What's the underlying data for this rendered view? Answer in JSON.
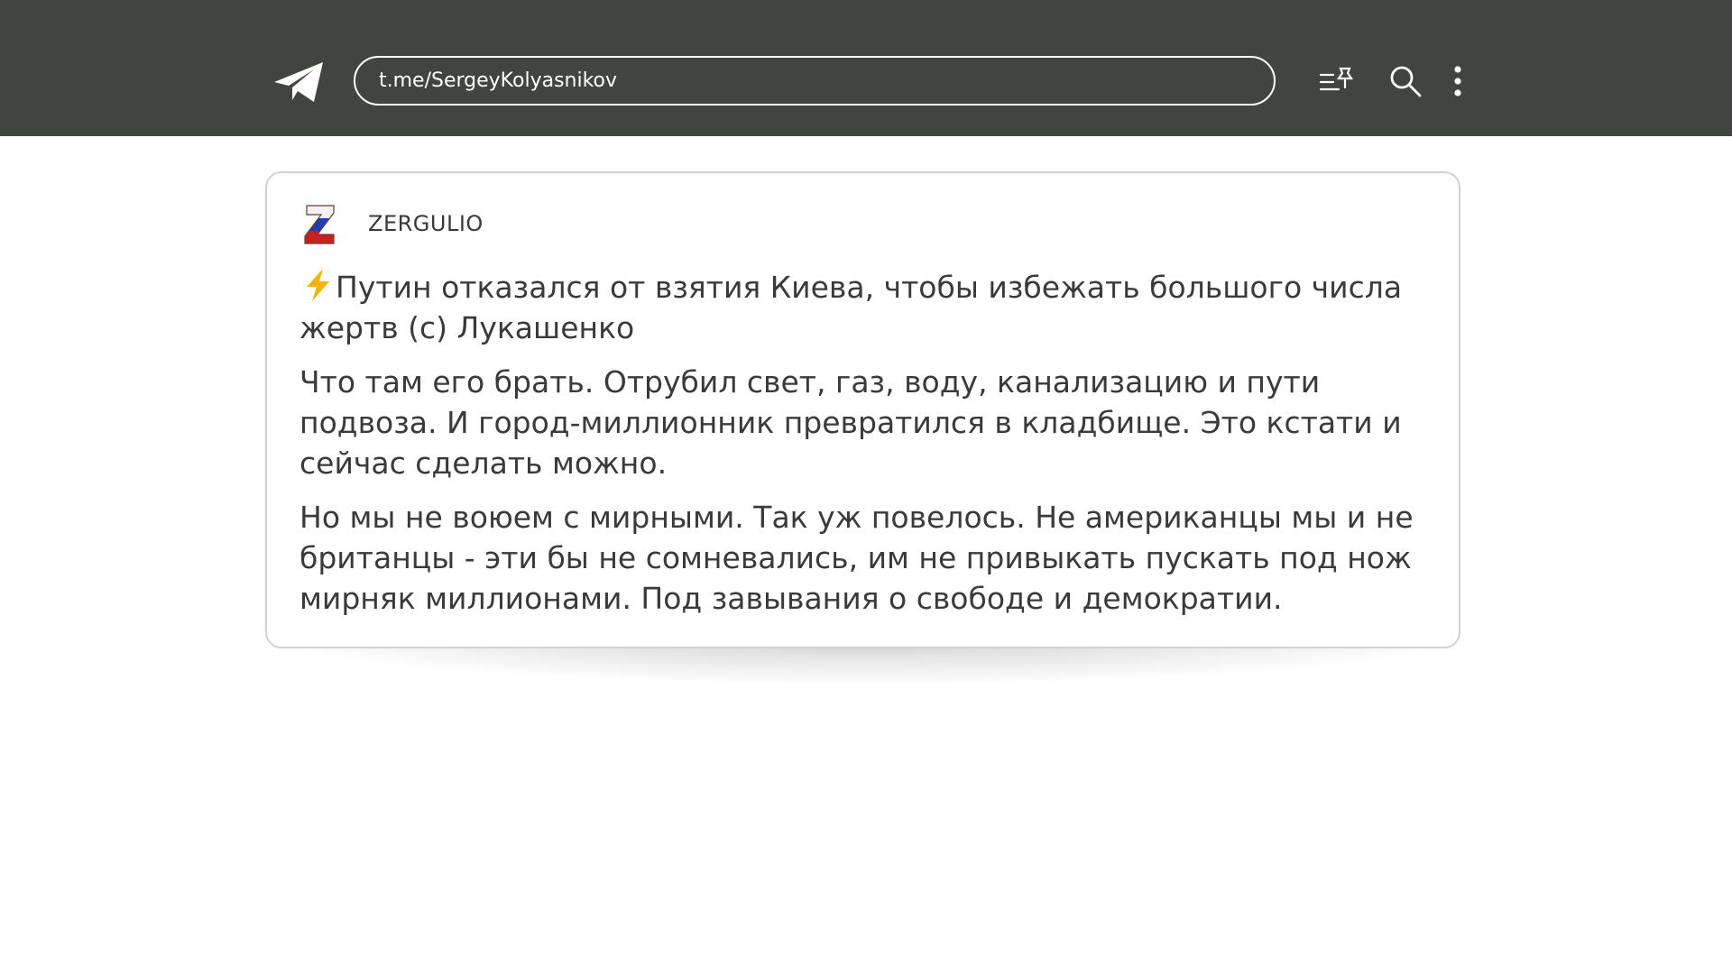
{
  "header": {
    "url": "t.me/SergeyKolyasnikov",
    "icons": [
      "telegram-logo-icon",
      "pinned-list-icon",
      "search-icon",
      "more-vertical-icon"
    ]
  },
  "post": {
    "channel_name": "ZERGULIO",
    "avatar_icon": "z-letter-tricolor-icon",
    "lead_icon": "lightning-bolt-icon",
    "paragraphs": [
      "Путин отказался от взятия Киева, чтобы избежать большого числа жертв (c) Лукашенко",
      "Что там его брать. Отрубил свет, газ, воду, канализацию и пути подвоза. И город-миллионник превратился в кладбище. Это кстати и сейчас сделать можно.",
      "Но мы не воюем с мирными. Так уж повелось. Не американцы мы и не британцы - эти бы не сомневались, им не привыкать пускать под нож мирняк миллионами. Под завывания о свободе и демократии."
    ]
  },
  "colors": {
    "header_bg": "#40453f",
    "text": "#3a3a3a",
    "card_border": "#d2d2d2",
    "bolt": "#f5b400"
  }
}
